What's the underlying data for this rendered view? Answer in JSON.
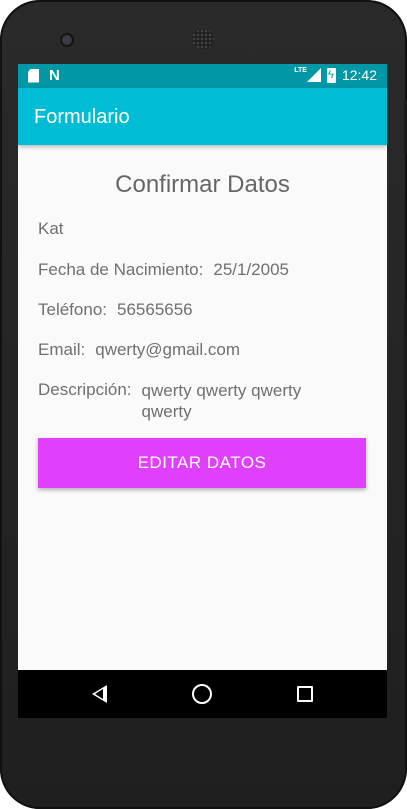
{
  "status_bar": {
    "time": "12:42",
    "network_label": "LTE"
  },
  "app_bar": {
    "title": "Formulario"
  },
  "form": {
    "heading": "Confirmar Datos",
    "name": "Kat",
    "birth_label": "Fecha de Nacimiento:",
    "birth_value": "25/1/2005",
    "phone_label": "Teléfono:",
    "phone_value": "56565656",
    "email_label": "Email:",
    "email_value": "qwerty@gmail.com",
    "description_label": "Descripción:",
    "description_value": "qwerty qwerty qwerty qwerty",
    "edit_button": "EDITAR DATOS"
  },
  "colors": {
    "status_bar": "#0097a7",
    "app_bar": "#00bcd4",
    "button": "#e040fb",
    "text": "#707070"
  }
}
